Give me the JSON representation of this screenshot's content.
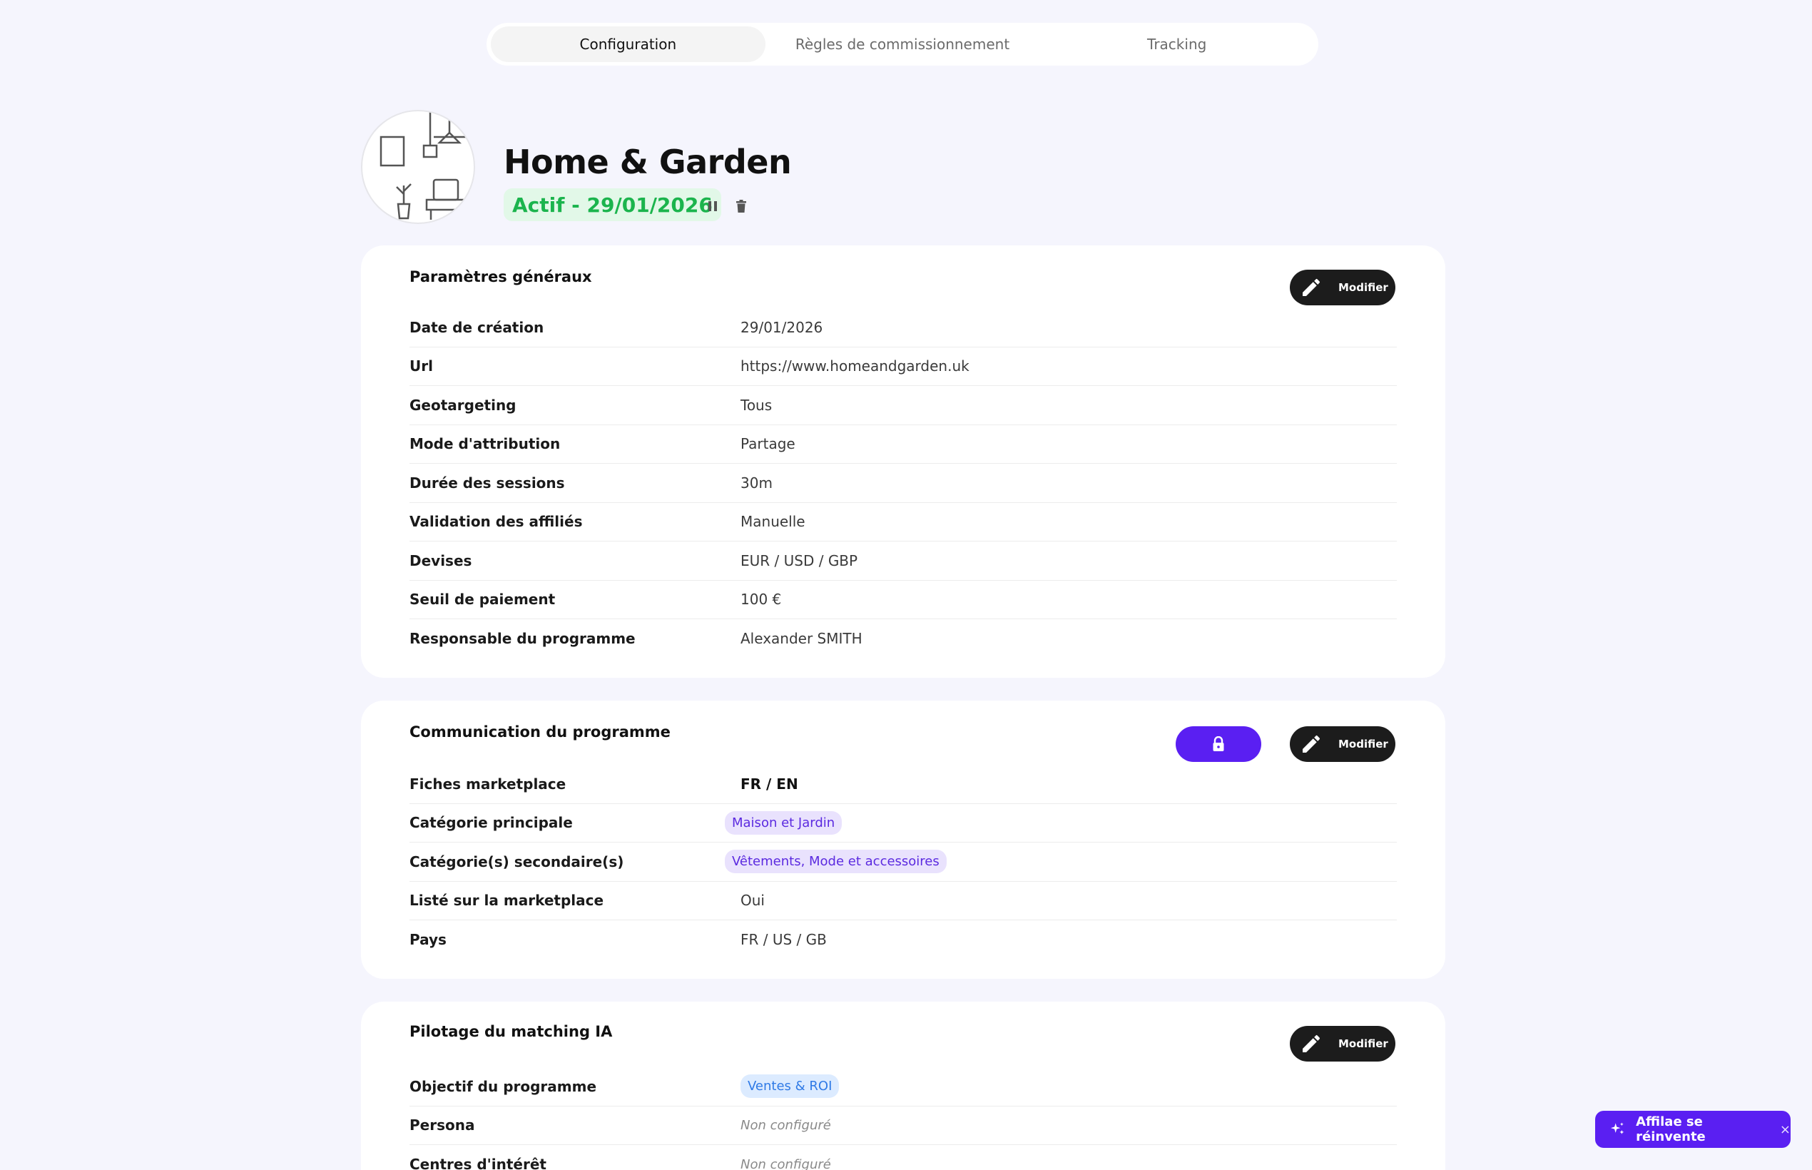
{
  "tabs": [
    {
      "label": "Configuration",
      "active": true
    },
    {
      "label": "Règles de commissionnement",
      "active": false
    },
    {
      "label": "Tracking",
      "active": false
    }
  ],
  "program": {
    "name": "Home & Garden",
    "status": "Actif - 29/01/2026"
  },
  "general": {
    "title": "Paramètres généraux",
    "edit_label": "Modifier",
    "rows": [
      {
        "label": "Date de création",
        "value": "29/01/2026"
      },
      {
        "label": "Url",
        "value": "https://www.homeandgarden.uk"
      },
      {
        "label": "Geotargeting",
        "value": "Tous"
      },
      {
        "label": "Mode d'attribution",
        "value": "Partage"
      },
      {
        "label": "Durée des sessions",
        "value": "30m"
      },
      {
        "label": "Validation des affiliés",
        "value": "Manuelle"
      },
      {
        "label": "Devises",
        "value": "EUR / USD / GBP"
      },
      {
        "label": "Seuil de paiement",
        "value": "100 €"
      },
      {
        "label": "Responsable du programme",
        "value": "Alexander SMITH"
      }
    ]
  },
  "communication": {
    "title": "Communication du programme",
    "edit_label": "Modifier",
    "rows": [
      {
        "label": "Fiches marketplace",
        "value": "FR / EN"
      },
      {
        "label": "Catégorie principale",
        "value": "Maison et Jardin"
      },
      {
        "label": "Catégorie(s) secondaire(s)",
        "value": "Vêtements, Mode et accessoires"
      },
      {
        "label": "Listé sur la marketplace",
        "value": "Oui"
      },
      {
        "label": "Pays",
        "value": "FR / US / GB"
      }
    ]
  },
  "matching": {
    "title": "Pilotage du matching IA",
    "edit_label": "Modifier",
    "rows": [
      {
        "label": "Objectif du programme",
        "value": "Ventes & ROI"
      },
      {
        "label": "Persona",
        "value": "Non configuré"
      },
      {
        "label": "Centres d'intérêt",
        "value": "Non configuré"
      }
    ]
  },
  "ai_banner": {
    "label": "Affilae se réinvente",
    "close": "×"
  },
  "colors": {
    "accent": "#5a1ff2",
    "status_green": "#1bb44d",
    "dark_button": "#1c1c1c",
    "background": "#f5f5fd"
  }
}
